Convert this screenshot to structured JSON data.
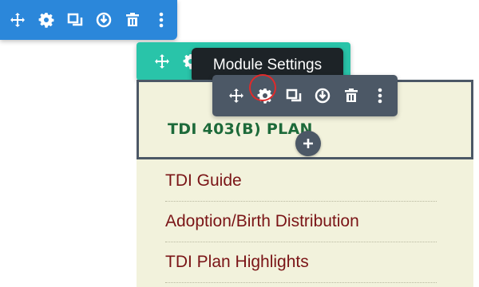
{
  "tooltip": {
    "text": "Module Settings"
  },
  "toolbars": {
    "section": {
      "color": "#2b87da",
      "icons": [
        "move-icon",
        "gear-icon",
        "duplicate-icon",
        "save-icon",
        "trash-icon",
        "more-icon"
      ]
    },
    "row": {
      "color": "#29c4a9",
      "icons": [
        "move-icon",
        "gear-icon"
      ]
    },
    "module": {
      "color": "#4c5866",
      "icons": [
        "move-icon",
        "gear-icon",
        "duplicate-icon",
        "save-icon",
        "trash-icon",
        "more-icon"
      ],
      "highlighted": "gear-icon"
    }
  },
  "module": {
    "title": "TDI 403(B) PLAN",
    "title_color": "#1d6a3a",
    "background": "#f2f2dc"
  },
  "links": [
    {
      "label": "TDI Guide"
    },
    {
      "label": "Adoption/Birth Distribution"
    },
    {
      "label": "TDI Plan Highlights"
    }
  ],
  "link_color": "#7a1416"
}
